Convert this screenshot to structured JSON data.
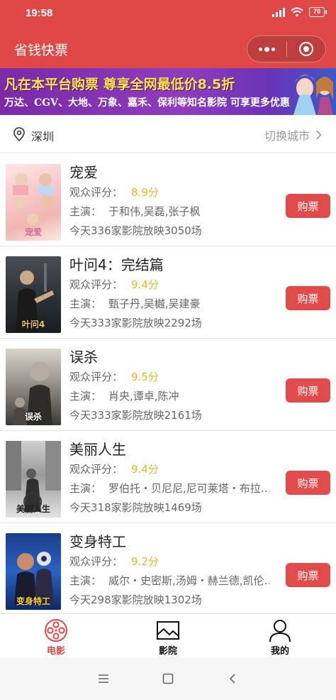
{
  "status_bar": {
    "time": "19:58",
    "battery": "70"
  },
  "header": {
    "title": "省钱快票",
    "more_icon": "more-dots-icon",
    "close_icon": "target-circle-icon"
  },
  "banner": {
    "line1": "凡在本平台购票 尊享全网最低价8.5折",
    "line2": "万达、CGV、大地、万象、嘉禾、保利等知名影院 可享更多优惠"
  },
  "location": {
    "city": "深圳",
    "switch_label": "切换城市"
  },
  "labels": {
    "rating_prefix": "观众评分：",
    "cast_prefix": "主演：",
    "buy": "购票"
  },
  "movies": [
    {
      "title": "宠爱",
      "score": "8.9分",
      "cast": "于和伟,吴磊,张子枫",
      "shows": "今天336家影院放映3050场",
      "poster_text": "宠爱"
    },
    {
      "title": "叶问4：完结篇",
      "score": "9.4分",
      "cast": "甄子丹,吴樾,吴建豪",
      "shows": "今天333家影院放映2292场",
      "poster_text": "叶问4"
    },
    {
      "title": "误杀",
      "score": "9.5分",
      "cast": "肖央,谭卓,陈冲",
      "shows": "今天333家影院放映2161场",
      "poster_text": "误杀"
    },
    {
      "title": "美丽人生",
      "score": "9.4分",
      "cast": "罗伯托・贝尼尼,尼可莱塔・布拉…",
      "shows": "今天318家影院放映1469场",
      "poster_text": "美丽人生"
    },
    {
      "title": "变身特工",
      "score": "9.2分",
      "cast": "威尔・史密斯,汤姆・赫兰德,凯伦…",
      "shows": "今天298家影院放映1302场",
      "poster_text": "变身特工"
    }
  ],
  "tabs": [
    {
      "label": "电影",
      "icon": "film-reel-icon",
      "active": true
    },
    {
      "label": "影院",
      "icon": "cinema-screen-icon",
      "active": false
    },
    {
      "label": "我的",
      "icon": "user-icon",
      "active": false
    }
  ],
  "colors": {
    "primary": "#e04848",
    "score": "#e5b72b",
    "banner_text": "#ffe34a"
  }
}
